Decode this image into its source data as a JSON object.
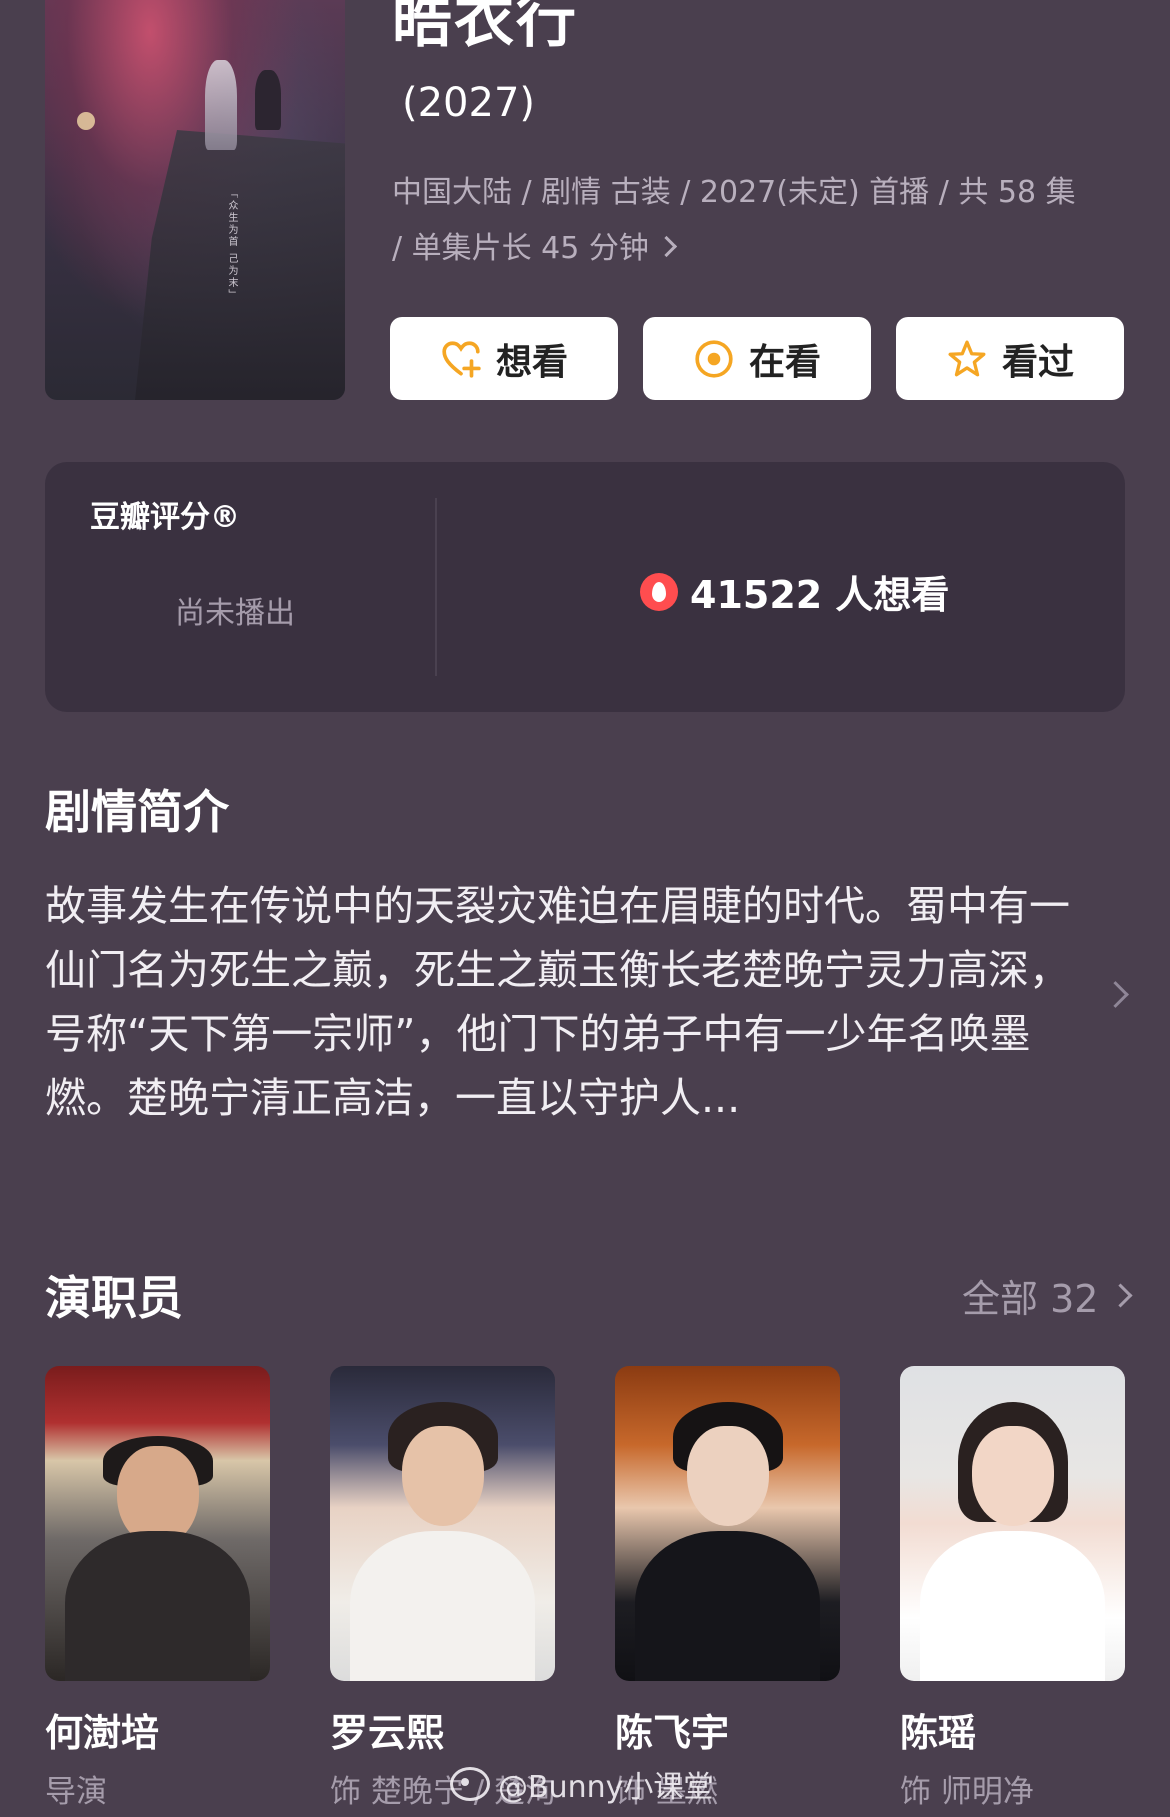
{
  "header": {
    "title": "皓衣行",
    "year": "(2027)",
    "meta": "中国大陆 / 剧情 古装 / 2027(未定) 首播 / 共 58 集 / 单集片长 45 分钟",
    "poster_vertical_text": "「众生为首 己为末」"
  },
  "actions": [
    {
      "label": "想看",
      "icon": "heart-plus-icon"
    },
    {
      "label": "在看",
      "icon": "target-icon"
    },
    {
      "label": "看过",
      "icon": "star-icon"
    }
  ],
  "rating": {
    "label": "豆瓣评分®",
    "status": "尚未播出",
    "want_count": "41522 人想看",
    "accent": "#ff4d4f"
  },
  "synopsis": {
    "title": "剧情简介",
    "text": "故事发生在传说中的天裂灾难迫在眉睫的时代。蜀中有一仙门名为死生之巅，死生之巅玉衡长老楚晚宁灵力高深，号称“天下第一宗师”，他门下的弟子中有一少年名唤墨燃。楚晚宁清正高洁，一直以守护人..."
  },
  "cast": {
    "title": "演职员",
    "all_label": "全部 32",
    "members": [
      {
        "name": "何澍培",
        "role": "导演"
      },
      {
        "name": "罗云熙",
        "role": "饰 楚晚宁 / 楚洵"
      },
      {
        "name": "陈飞宇",
        "role": "饰 墨燃"
      },
      {
        "name": "陈瑶",
        "role": "饰 师明净"
      }
    ]
  },
  "watermark": "@Bunny小课堂",
  "colors": {
    "background": "#4a3f4e",
    "card": "#3a3140",
    "button_icon": "#f5a623"
  }
}
